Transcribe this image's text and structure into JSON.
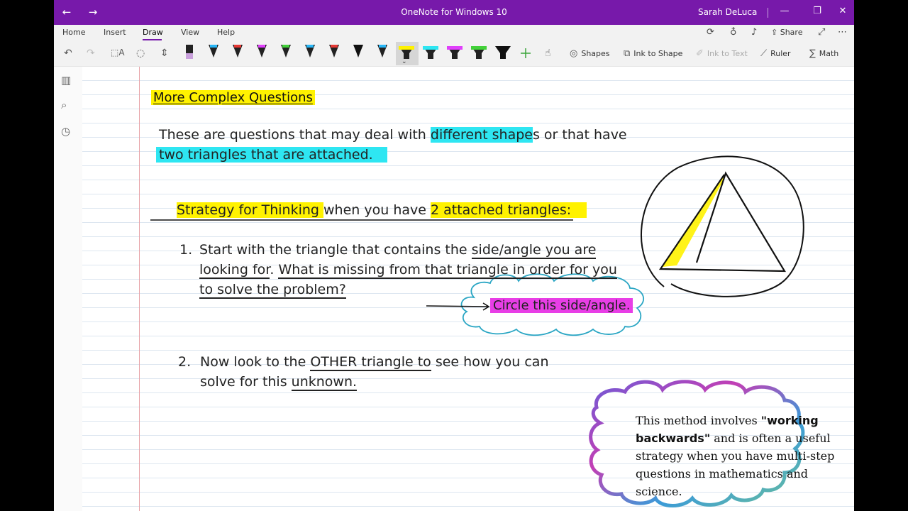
{
  "window": {
    "title": "OneNote for Windows 10",
    "user": "Sarah DeLuca"
  },
  "menu": {
    "tabs": [
      "Home",
      "Insert",
      "Draw",
      "View",
      "Help"
    ],
    "active_tab": "Draw",
    "share_label": "Share"
  },
  "toolbar": {
    "tools": {
      "shapes": "Shapes",
      "ink_to_shape": "Ink to Shape",
      "ink_to_text": "Ink to Text",
      "ruler": "Ruler",
      "math": "Math"
    },
    "pen_colors": [
      "#c9a0dc",
      "#29b6f6",
      "#e53935",
      "#e040fb",
      "#43d13a",
      "#29b6f6",
      "#e53935",
      "#111111",
      "#29b6f6",
      "#fff200",
      "#2ee6f2",
      "#e040fb",
      "#43d13a",
      "#111111"
    ]
  },
  "note": {
    "heading": "More Complex Questions",
    "intro": {
      "line1_a": "These are questions that may deal with ",
      "line1_hl": "different shape",
      "line1_b": "s or that have",
      "line2_hl": "two triangles that are attached."
    },
    "strategy": {
      "a": "Strategy for Thinking ",
      "b": "when you have ",
      "c": "2 attached triangles:"
    },
    "step1": {
      "num": "1.",
      "l1_a": "Start with the triangle that contains the ",
      "l1_u": "side/angle you are",
      "l2_u1": "looking for",
      "l2_b": ". ",
      "l2_u2": "What is missing from that triangle in order for you",
      "l3_u": "to solve the problem?",
      "cloud_text": "Circle this side/angle."
    },
    "step2": {
      "num": "2.",
      "l1_a": "Now look to the ",
      "l1_u": "OTHER triangle to",
      "l1_b": " see how you can",
      "l2_a": "solve for this ",
      "l2_u": "unknown."
    },
    "callout": {
      "pre": "This method involves ",
      "bold": "\"working backwards\"",
      "post": " and is often a useful strategy when you have multi-step questions in mathematics and science."
    }
  },
  "colors": {
    "accent": "#7719aa",
    "highlight_yellow": "#fff200",
    "highlight_cyan": "#2ee6f2",
    "highlight_magenta": "#e83ee6"
  }
}
